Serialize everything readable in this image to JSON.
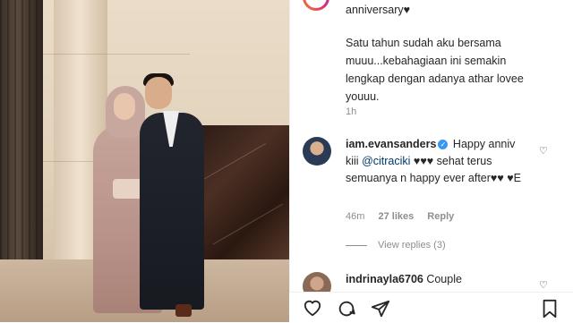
{
  "caption": {
    "top_line": "anniversary♥",
    "body": "Satu tahun sudah aku bersama muuu...kebahagiaan ini semakin lengkap dengan adanya athar lovee youuu.",
    "time": "1h"
  },
  "comments": [
    {
      "username": "iam.evansanders",
      "text_before": " Happy anniv kiii ",
      "mention": "@citraciki",
      "text_after": " ♥♥♥ sehat terus semuanya n happy ever after♥♥ ♥E",
      "time": "46m",
      "likes": "27 likes",
      "reply": "Reply",
      "view_replies": "View replies (3)"
    },
    {
      "username": "indrinayla6706",
      "text": " Couple"
    }
  ],
  "icons": [
    "heart-icon",
    "comment-icon",
    "share-icon",
    "bookmark-icon",
    "verified-icon"
  ]
}
